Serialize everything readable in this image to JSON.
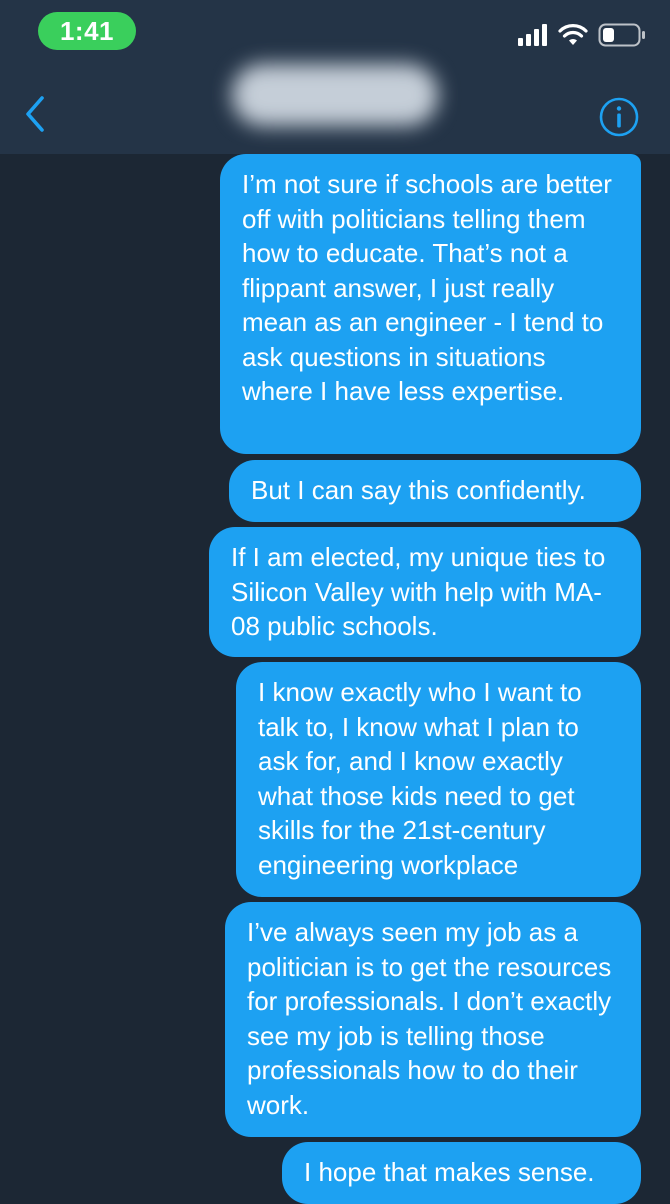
{
  "status_bar": {
    "time": "1:41",
    "icons": [
      "cellular-signal-icon",
      "wifi-icon",
      "battery-icon"
    ],
    "accent_color": "#3acf5c"
  },
  "nav_bar": {
    "back_icon": "chevron-left-icon",
    "contact_name": "",
    "info_icon": "info-icon",
    "accent_color": "#1da1f2"
  },
  "messages": [
    {
      "text": "I’m not sure if schools are better off with politicians telling them how to educate. That’s not a flippant answer, I just really mean as an engineer - I tend to ask questions in situations where I have less expertise."
    },
    {
      "text": "But I can say this confidently."
    },
    {
      "text": "If I am elected, my unique ties to Silicon Valley with help with MA-08 public schools."
    },
    {
      "text": "I know exactly who I want to talk to, I know what I plan to ask for, and I know exactly what those kids need to get skills for the 21st-century engineering workplace"
    },
    {
      "text": "I’ve always seen my job as a politician is to get the resources for professionals. I don’t exactly see my job is telling those professionals how to do their work."
    },
    {
      "text": "I hope that makes sense."
    }
  ],
  "colors": {
    "background": "#1c2734",
    "header": "#243447",
    "bubble": "#1da1f2"
  }
}
